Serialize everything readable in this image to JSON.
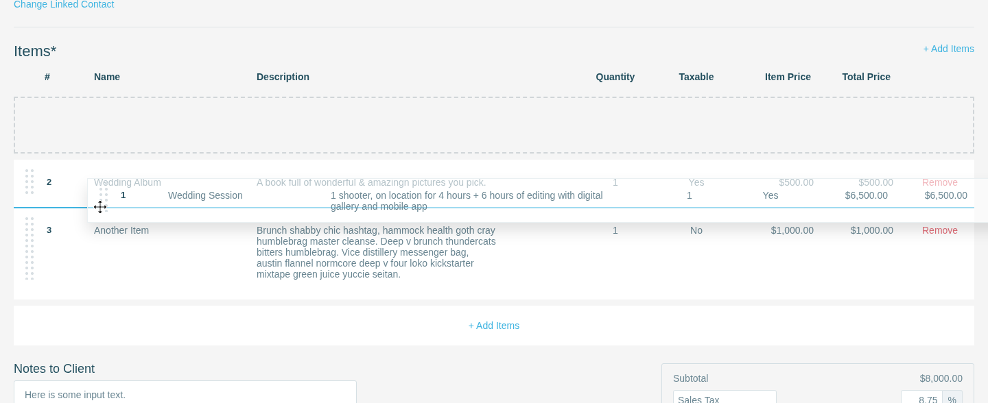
{
  "contact_link": "Change Linked Contact",
  "items": {
    "title": "Items*",
    "add_link": "+ Add Items",
    "columns": [
      "#",
      "Name",
      "Description",
      "Quantity",
      "Taxable",
      "Item Price",
      "Total Price"
    ],
    "rows": [
      {
        "number": "2",
        "name": "Wedding Album",
        "description": "A book full of wonderful & amazingn pictures you pick.",
        "quantity": "1",
        "taxable": "Yes",
        "item_price": "$500.00",
        "total_price": "$500.00",
        "action": "Remove"
      },
      {
        "number": "3",
        "name": "Another Item",
        "description": "Brunch shabby chic hashtag, hammock health goth cray humblebrag master cleanse. Deep v brunch thundercats bitters humblebrag. Vice distillery messenger bag, austin flannel normcore deep v four loko kickstarter mixtape green juice yuccie seitan.",
        "quantity": "1",
        "taxable": "No",
        "item_price": "$1,000.00",
        "total_price": "$1,000.00",
        "action": "Remove"
      }
    ],
    "dragged_row": {
      "number": "1",
      "name": "Wedding Session",
      "description": "1 shooter, on location for 4 hours + 6 hours of editing with digital gallery and mobile app",
      "quantity": "1",
      "taxable": "Yes",
      "item_price": "$6,500.00",
      "total_price": "$6,500.00"
    },
    "add_button": "+ Add Items"
  },
  "notes": {
    "title": "Notes to Client",
    "value": "Here is some input text."
  },
  "summary": {
    "subtotal_label": "Subtotal",
    "subtotal": "$8,000.00",
    "tax_name": "Sales Tax",
    "tax_rate": "8.75",
    "tax_unit": "%"
  }
}
